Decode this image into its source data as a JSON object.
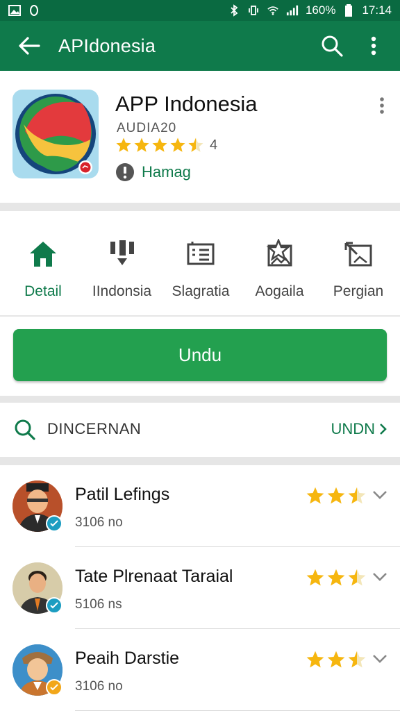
{
  "status_bar": {
    "battery": "160%",
    "time": "17:14"
  },
  "app_bar": {
    "title": "APIdonesia",
    "back_icon": "arrow-left-icon",
    "search_icon": "search-icon",
    "menu_icon": "more-vertical-icon"
  },
  "app": {
    "name": "APP Indonesia",
    "developer": "AUDIA20",
    "rating_stars": 4.5,
    "rating_text": "4",
    "badge_text": "Hamag"
  },
  "tabs": [
    {
      "label": "Detail",
      "icon": "home-icon",
      "active": true
    },
    {
      "label": "IIndonsia",
      "icon": "download-list-icon",
      "active": false
    },
    {
      "label": "Slagratia",
      "icon": "list-card-icon",
      "active": false
    },
    {
      "label": "Aogaila",
      "icon": "star-image-icon",
      "active": false
    },
    {
      "label": "Pergian",
      "icon": "expand-image-icon",
      "active": false
    }
  ],
  "install_button": "Undu",
  "search_section": {
    "label": "DINCERNAN",
    "action": "UNDN"
  },
  "list": [
    {
      "name": "Patil Lefings",
      "meta": "3106 no",
      "stars": 2.5,
      "badge_color": "#1c9dc1"
    },
    {
      "name": "Tate Plrenaat Taraial",
      "meta": "5106 ns",
      "stars": 2.5,
      "badge_color": "#1c9dc1"
    },
    {
      "name": "Peaih Darstie",
      "meta": "3106 no",
      "stars": 2.5,
      "badge_color": "#f2a71a"
    }
  ],
  "colors": {
    "primary": "#0f7a4b",
    "status_bar": "#0a6a41",
    "install": "#23a04f",
    "star": "#f6b60f"
  }
}
